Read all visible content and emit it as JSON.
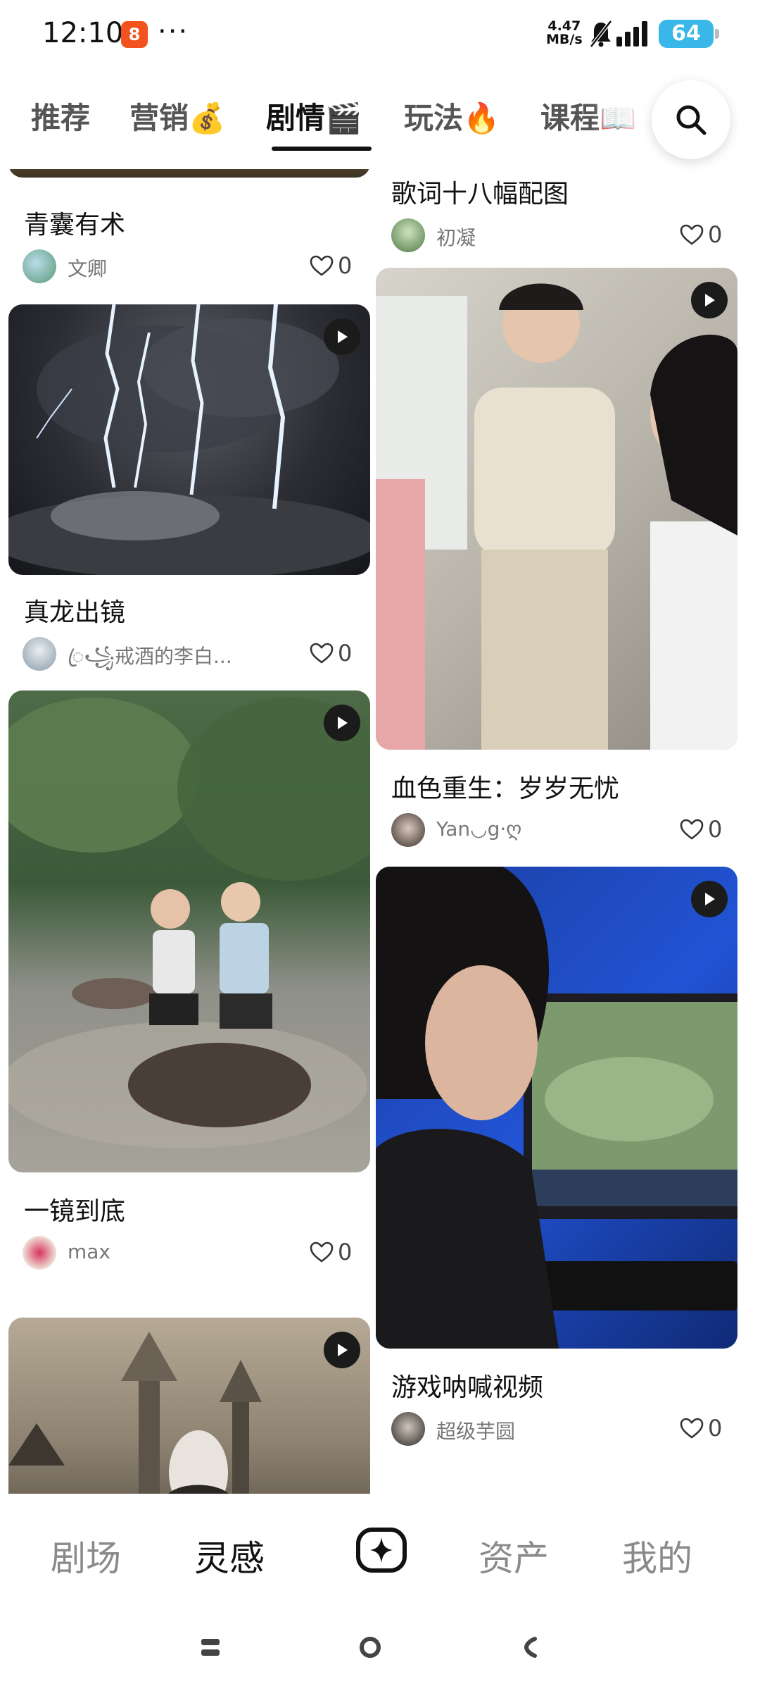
{
  "status_bar": {
    "time": "12:10",
    "app_icon_glyph": "8",
    "more": "···",
    "net_speed_value": "4.47",
    "net_speed_unit": "MB/s",
    "battery": "64",
    "icons": [
      "app-notification-icon",
      "bell-muted-icon",
      "signal-icon",
      "battery-icon"
    ]
  },
  "tabs": [
    {
      "label": "推荐",
      "emoji": ""
    },
    {
      "label": "营销",
      "emoji": "💰"
    },
    {
      "label": "剧情",
      "emoji": "🎬"
    },
    {
      "label": "玩法",
      "emoji": "🔥"
    },
    {
      "label": "课程",
      "emoji": "📖"
    }
  ],
  "active_tab": "剧情",
  "cards": [
    {
      "title": "青囊有术",
      "author": "文卿",
      "likes": "0"
    },
    {
      "title": "歌词十八幅配图",
      "author": "初凝",
      "likes": "0"
    },
    {
      "title": "真龙出镜",
      "author": "ꦿ꧁戒酒的李白...",
      "likes": "0"
    },
    {
      "title": "血色重生：岁岁无忧",
      "author": "Yan◡g·ღ",
      "likes": "0"
    },
    {
      "title": "一镜到底",
      "author": "max",
      "likes": "0"
    },
    {
      "title": "游戏呐喊视频",
      "author": "超级芋圆",
      "likes": "0"
    }
  ],
  "bottom_nav": {
    "items": [
      "剧场",
      "灵感",
      "资产",
      "我的"
    ],
    "active": "灵感",
    "create_icon": "sparkle-create-icon"
  },
  "colors": {
    "accent": "#111111",
    "battery": "#38b7e8",
    "app_icon": "#f2531e",
    "inactive": "#8a8a8a"
  }
}
